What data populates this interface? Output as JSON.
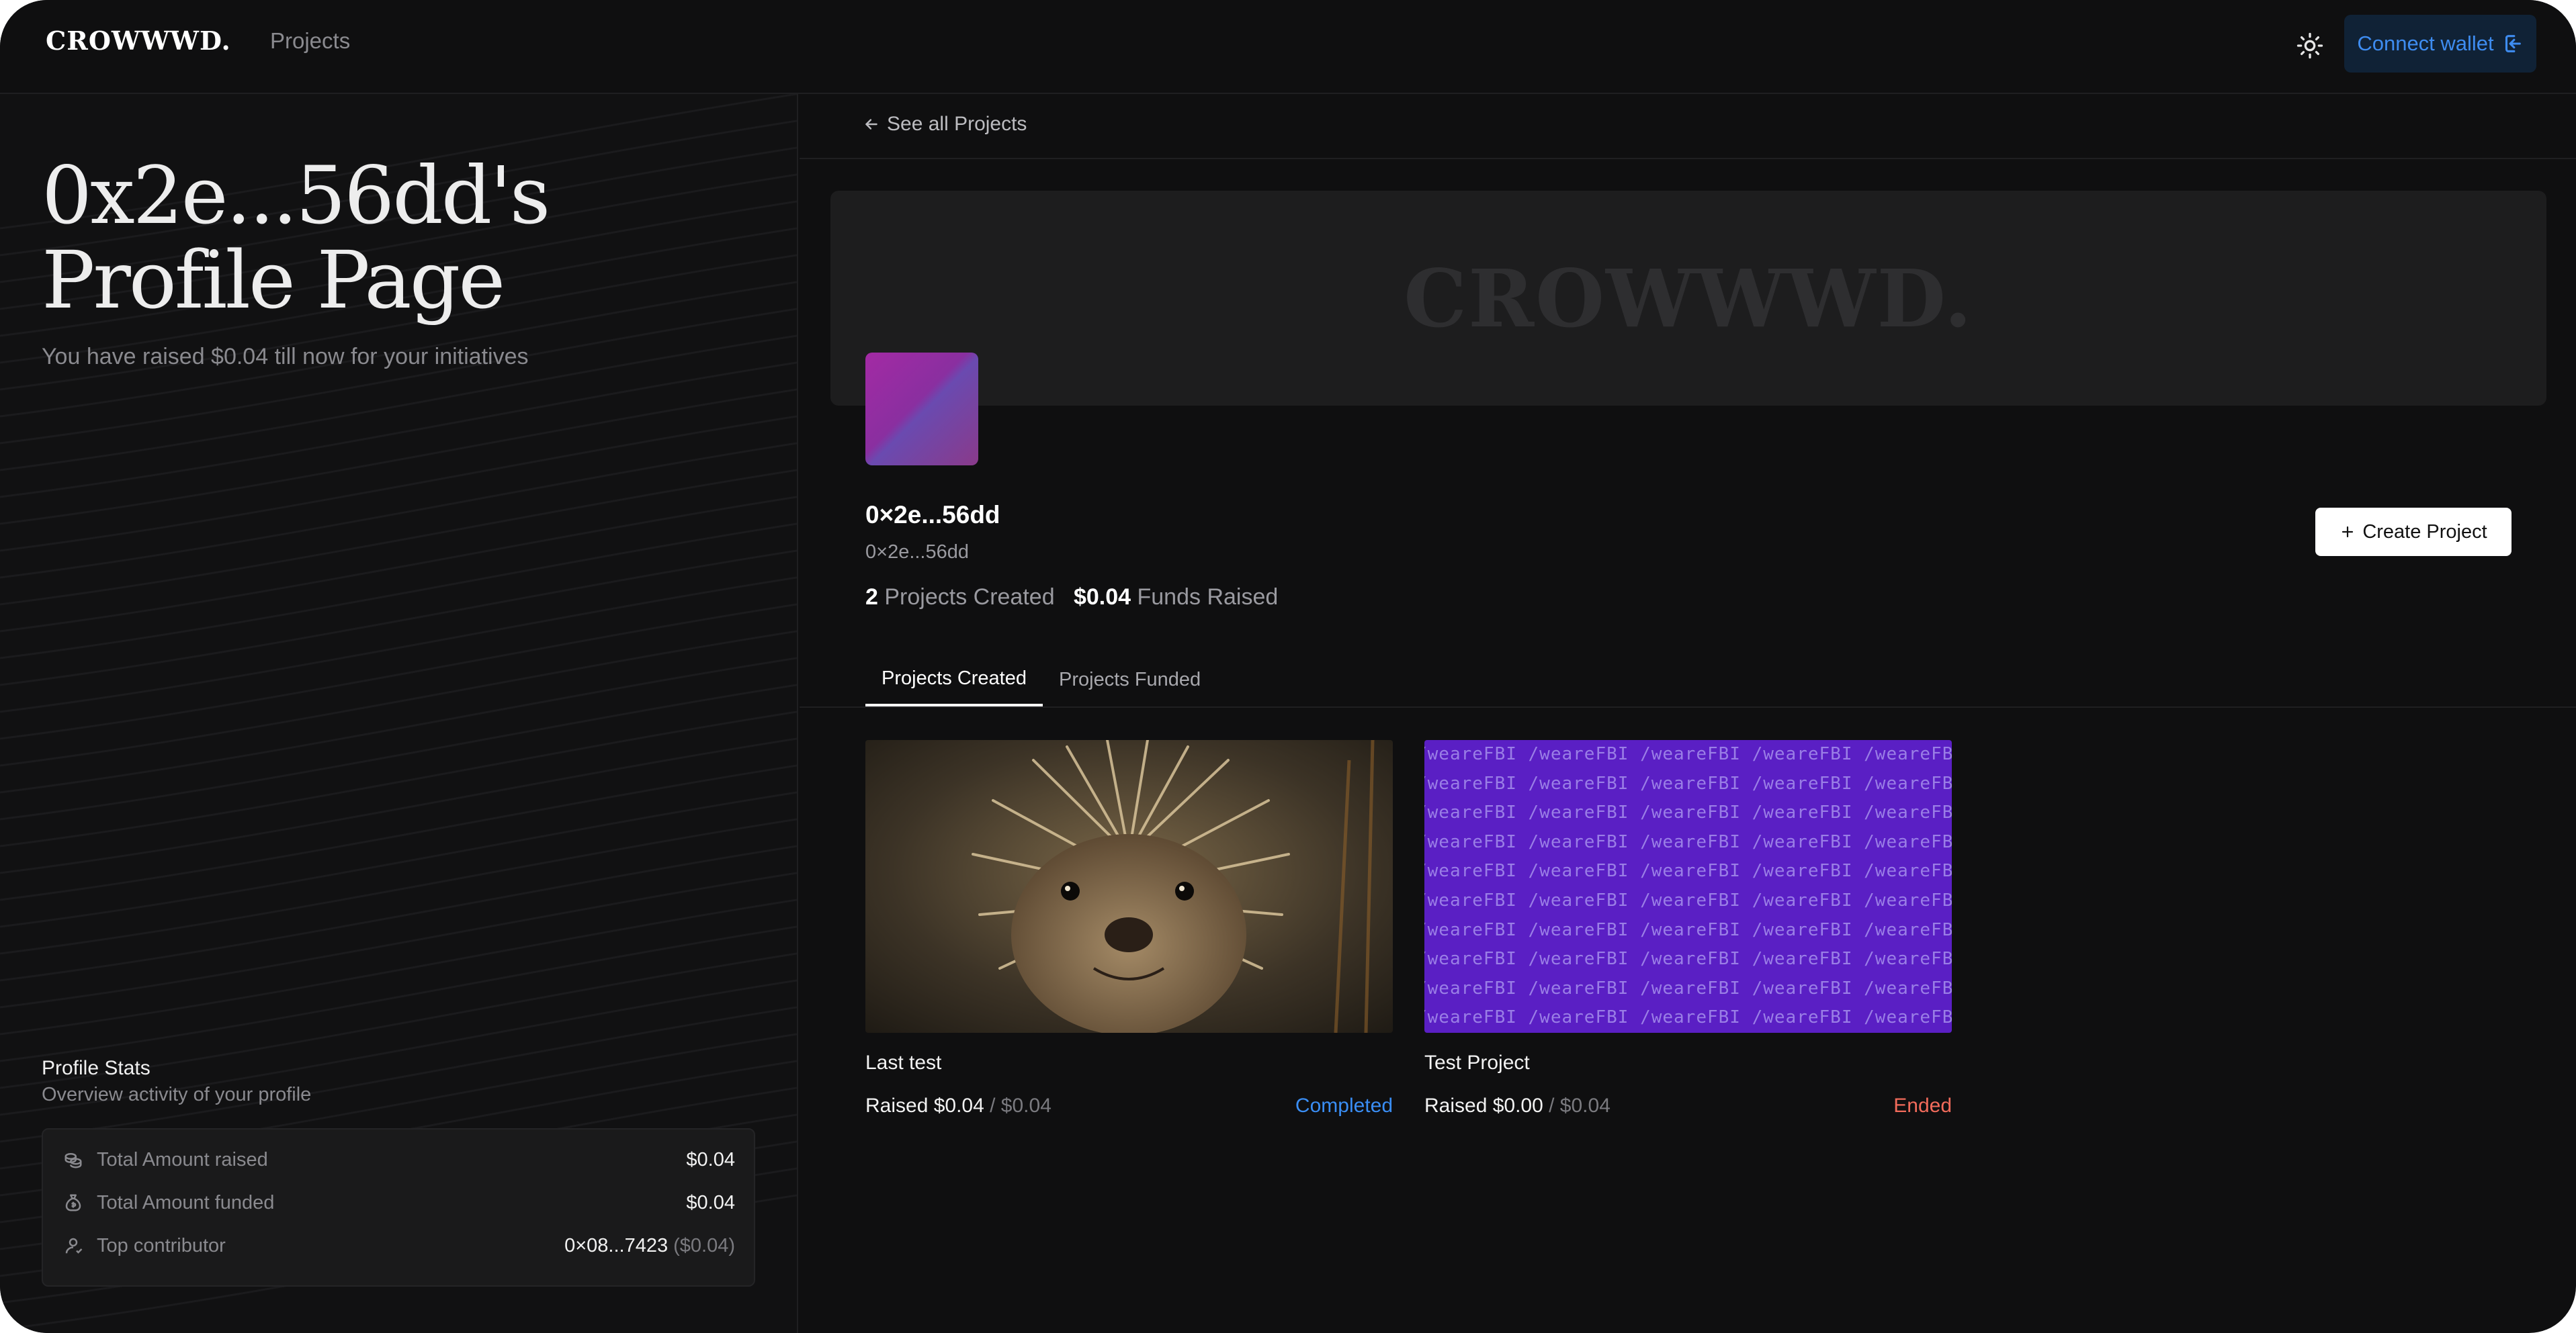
{
  "nav": {
    "logo": "CROWWWD.",
    "projects_link": "Projects",
    "theme_icon": "sun-icon",
    "connect_wallet": "Connect wallet",
    "connect_icon": "wallet-login-icon"
  },
  "left": {
    "title_line1": "0x2e...56dd's",
    "title_line2": "Profile Page",
    "subtitle": "You have raised $0.04 till now for your initiatives",
    "stats": {
      "title": "Profile Stats",
      "subtitle": "Overview activity of your profile",
      "rows": [
        {
          "icon": "coins-icon",
          "label": "Total Amount raised",
          "value": "$0.04",
          "extra": ""
        },
        {
          "icon": "money-bag-icon",
          "label": "Total Amount funded",
          "value": "$0.04",
          "extra": ""
        },
        {
          "icon": "user-icon",
          "label": "Top contributor",
          "value": "0×08...7423",
          "extra": "($0.04)"
        }
      ]
    }
  },
  "right": {
    "back_link": "See all Projects",
    "banner_logo": "CROWWWD.",
    "profile_name": "0×2e...56dd",
    "profile_address": "0×2e...56dd",
    "projects_created_count": "2",
    "projects_created_label": "Projects Created",
    "funds_raised_value": "$0.04",
    "funds_raised_label": "Funds Raised",
    "create_project": "Create Project",
    "tabs": [
      {
        "label": "Projects Created",
        "active": true
      },
      {
        "label": "Projects Funded",
        "active": false
      }
    ],
    "cards": [
      {
        "title": "Last test",
        "raised": "Raised $0.04",
        "goal": "/ $0.04",
        "status": "Completed",
        "status_color": "#3a8ef5",
        "image": "hedgehog-photo"
      },
      {
        "title": "Test Project",
        "raised": "Raised $0.00",
        "goal": "/ $0.04",
        "status": "Ended",
        "status_color": "#f26b5b",
        "image": "purple-pattern",
        "pattern_text": "/weareFBI /weareFBI /weareFBI /weareFBI /weareFBI /weareFBI"
      }
    ]
  },
  "colors": {
    "background": "#0f0f10",
    "accent_blue": "#3e8cf0",
    "completed": "#3a8ef5",
    "ended": "#f26b5b",
    "card_purple": "#5a1fc4"
  }
}
